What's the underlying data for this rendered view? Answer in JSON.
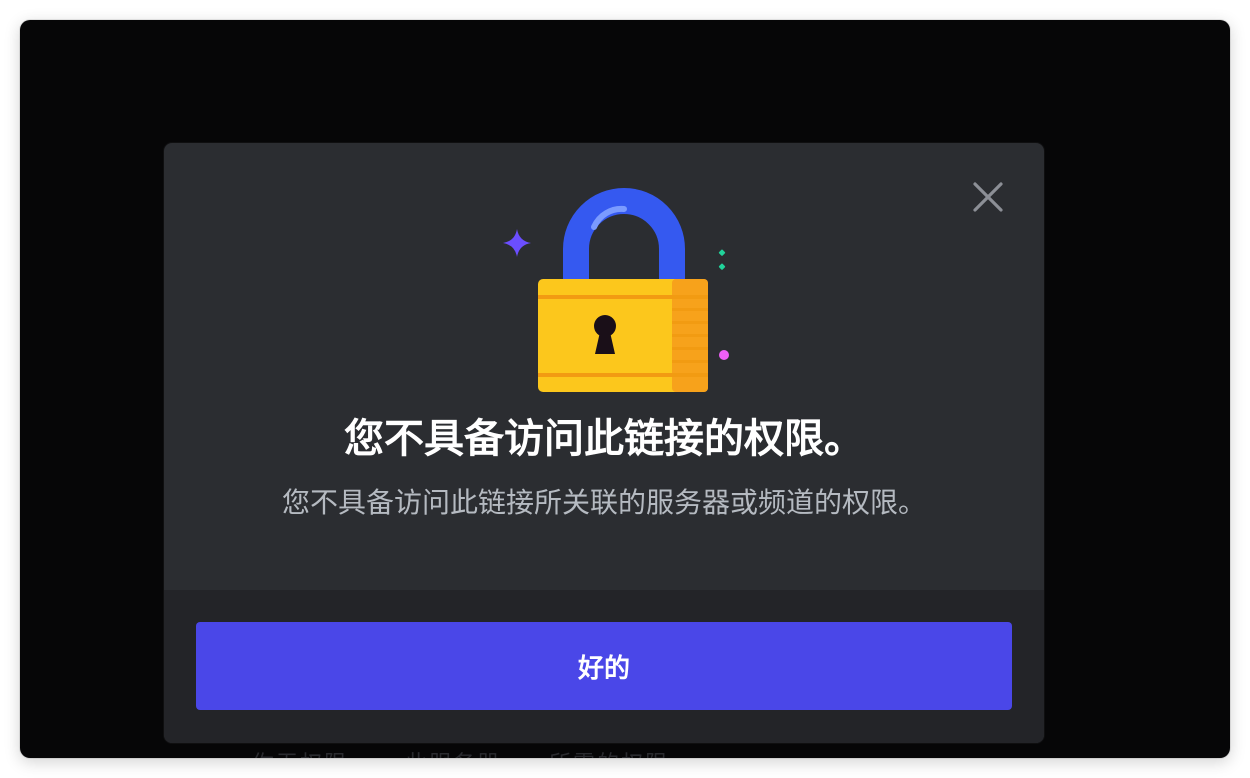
{
  "background": {
    "partial_text": "你无权限……   此服务器……所需的权限。"
  },
  "modal": {
    "title": "您不具备访问此链接的权限。",
    "subtitle": "您不具备访问此链接所关联的服务器或频道的权限。",
    "ok_button_label": "好的",
    "close_icon": "close-icon",
    "illustration": "padlock-icon"
  },
  "colors": {
    "window_background": "#060607",
    "modal_background": "#2b2d31",
    "footer_background": "#232428",
    "button_primary": "#4a47e8",
    "title_text": "#ffffff",
    "subtitle_text": "#b5bac1",
    "lock_body": "#fcc71c",
    "lock_shackle": "#3559f0",
    "sparkle_purple": "#6b4eff",
    "sparkle_green": "#21d39b",
    "dot_pink": "#ee5ff7"
  }
}
